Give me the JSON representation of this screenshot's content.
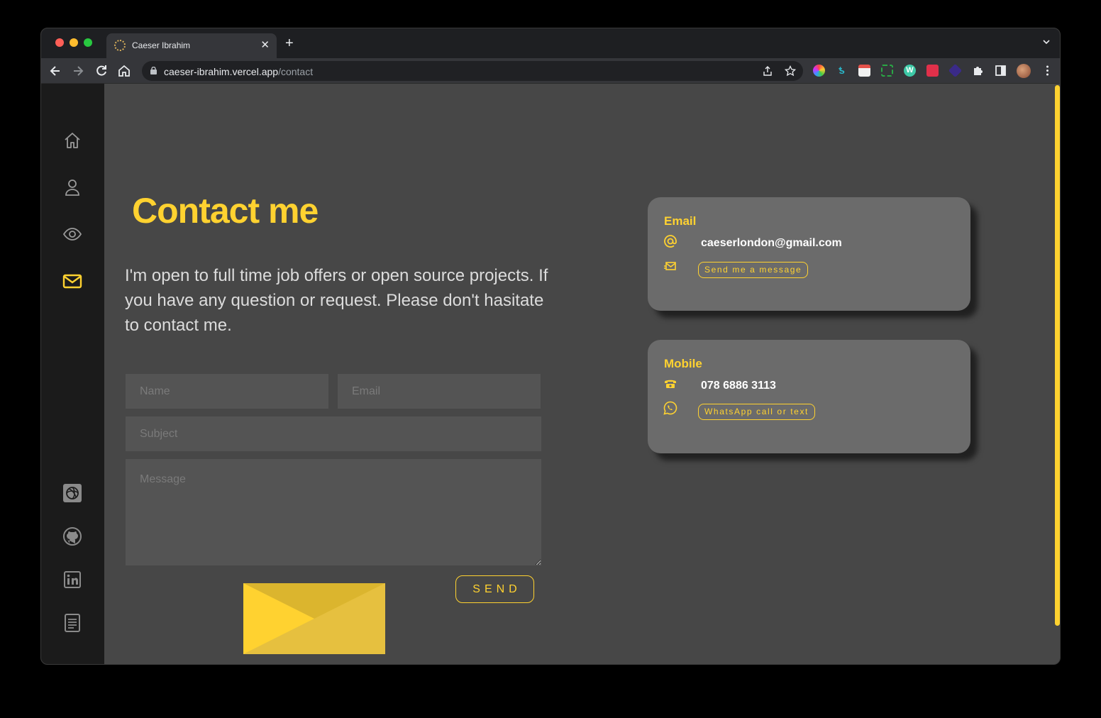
{
  "browser": {
    "tab_title": "Caeser Ibrahim",
    "url_host": "caeser-ibrahim.vercel.app",
    "url_path": "/contact"
  },
  "sidebar": {
    "items": [
      {
        "icon": "home-icon",
        "active": false
      },
      {
        "icon": "user-icon",
        "active": false
      },
      {
        "icon": "eye-icon",
        "active": false
      },
      {
        "icon": "mail-icon",
        "active": true
      }
    ],
    "social": [
      "codepen-icon",
      "github-icon",
      "linkedin-icon",
      "resume-icon"
    ]
  },
  "contact": {
    "title": "Contact me",
    "intro": "I'm open to full time job offers or open source projects. If you have any question or request. Please don't hasitate to contact me.",
    "form": {
      "name_placeholder": "Name",
      "email_placeholder": "Email",
      "subject_placeholder": "Subject",
      "message_placeholder": "Message",
      "send_label": "SEND"
    }
  },
  "cards": {
    "email": {
      "title": "Email",
      "value": "caeserlondon@gmail.com",
      "link": "Send me a message"
    },
    "mobile": {
      "title": "Mobile",
      "value": "078 6886 3113",
      "link": "WhatsApp call or text"
    }
  },
  "colors": {
    "accent": "#ffd230",
    "background": "#474747",
    "sidebar": "#1b1b1b",
    "card": "#6b6b6b"
  }
}
